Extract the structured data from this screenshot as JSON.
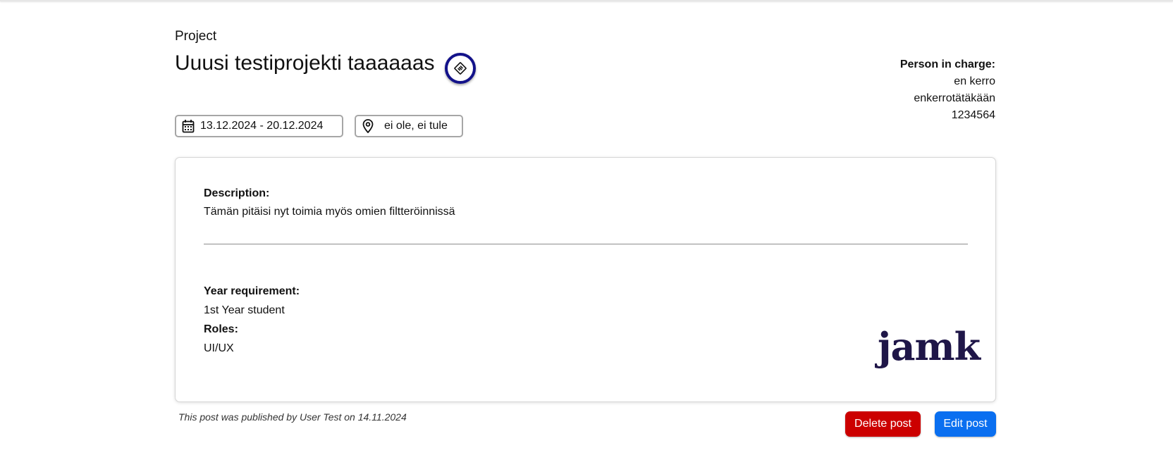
{
  "header": {
    "kicker": "Project",
    "title": "Uuusi testiprojekti taaaaaas"
  },
  "person_in_charge": {
    "label": "Person in charge:",
    "name": "en kerro",
    "email": "enkerrotätäkään",
    "phone": "1234564"
  },
  "chips": {
    "date": "13.12.2024  - 20.12.2024",
    "location": "ei ole, ei tule"
  },
  "card": {
    "description_label": "Description:",
    "description": "Tämän pitäisi nyt toimia myös omien filtteröinnissä",
    "year_label": "Year requirement:",
    "year": "1st Year student",
    "roles_label": "Roles:",
    "roles": "UI/UX",
    "logo_text": "jamk"
  },
  "footer": {
    "published_note": "This post was published by User Test on 14.11.2024",
    "delete_label": "Delete post",
    "edit_label": "Edit post"
  },
  "colors": {
    "badge_ring": "#13128a",
    "delete": "#cc0000",
    "edit": "#0a6ff0",
    "logo": "#1f1648"
  },
  "icons": {
    "badge": "handshake-icon",
    "date": "calendar-icon",
    "location": "map-pin-icon"
  }
}
